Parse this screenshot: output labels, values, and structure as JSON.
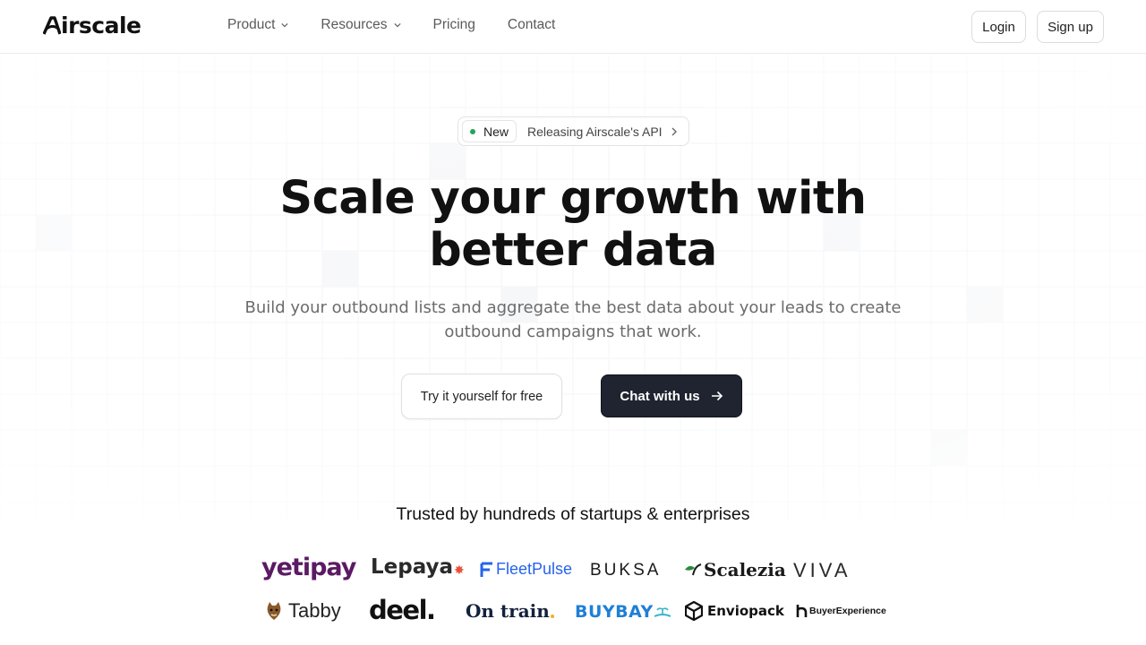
{
  "header": {
    "logo_text": "irscale",
    "nav": [
      {
        "label": "Product",
        "has_dropdown": true
      },
      {
        "label": "Resources",
        "has_dropdown": true
      },
      {
        "label": "Pricing",
        "has_dropdown": false
      },
      {
        "label": "Contact",
        "has_dropdown": false
      }
    ],
    "login_label": "Login",
    "signup_label": "Sign up"
  },
  "hero": {
    "badge_tag": "New",
    "badge_text": "Releasing Airscale's API",
    "headline_line1": "Scale your growth with",
    "headline_line2": "better data",
    "subtitle_line1": "Build your outbound lists and aggregate the best data about your leads to create",
    "subtitle_line2": "outbound campaigns that work.",
    "cta_secondary": "Try it yourself for free",
    "cta_primary": "Chat with us"
  },
  "trusted": {
    "heading": "Trusted by hundreds of startups & enterprises",
    "logos_row1": [
      "yetipay",
      "Lepaya",
      "FleetPulse",
      "BUKSA",
      "Scalezia",
      "VIVA"
    ],
    "logos_row2": [
      "Tabby",
      "deel.",
      "On train",
      "BUYBAY",
      "Enviopack",
      "BuyerExperience"
    ]
  },
  "colors": {
    "primary_button": "#1f2430",
    "status_dot": "#22a55a",
    "yetipay": "#5b1a63",
    "lepaya_dot": "#e8543b",
    "fleetpulse": "#2563eb",
    "buybay": "#1f7fd6",
    "scalezia_leaf": "#2a8a3e"
  }
}
